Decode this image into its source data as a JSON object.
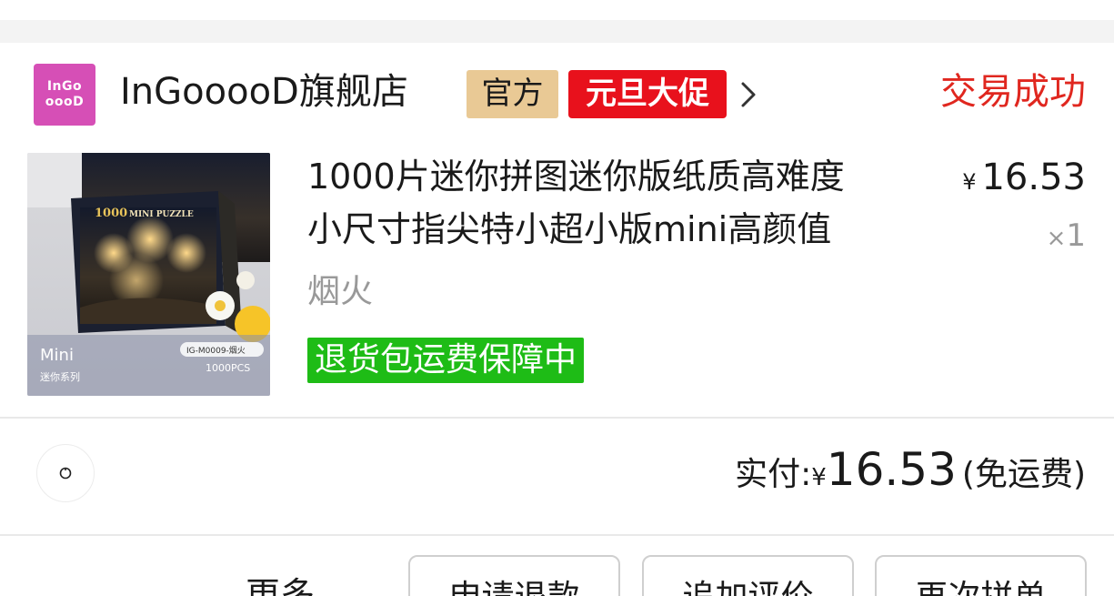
{
  "shop": {
    "logo_line1": "InGo",
    "logo_line2": "oooD",
    "name": "InGooooD旗舰店",
    "badge_official": "官方",
    "badge_promo": "元旦大促",
    "arrow_icon": "chevron-right-icon"
  },
  "order": {
    "status": "交易成功"
  },
  "product": {
    "title_line1": "1000片迷你拼图迷你版纸质高难度",
    "title_line2": "小尺寸指尖特小超小版mini高颜值",
    "price_symbol": "¥",
    "price": "16.53",
    "qty_prefix": "×",
    "qty": "1",
    "variant": "烟火",
    "guarantee": "退货包运费保障中",
    "image": {
      "box_number": "1000",
      "box_title": "MINI PUZZLE",
      "brand": "Mini",
      "series": "迷你系列",
      "sku": "IG-M0009-烟火",
      "pieces": "1000PCS"
    }
  },
  "payment": {
    "label": "实付:",
    "symbol": "¥",
    "amount": "16.53",
    "note": "(免运费)"
  },
  "actions": {
    "more": "更多",
    "refund": "申请退款",
    "review": "追加评价",
    "rebuy": "再次拼单"
  },
  "colors": {
    "status_red": "#e0271f",
    "promo_red": "#e8111c",
    "official_gold": "#e9c995",
    "guarantee_green": "#1ebc16",
    "logo_pink": "#d64fb6"
  }
}
